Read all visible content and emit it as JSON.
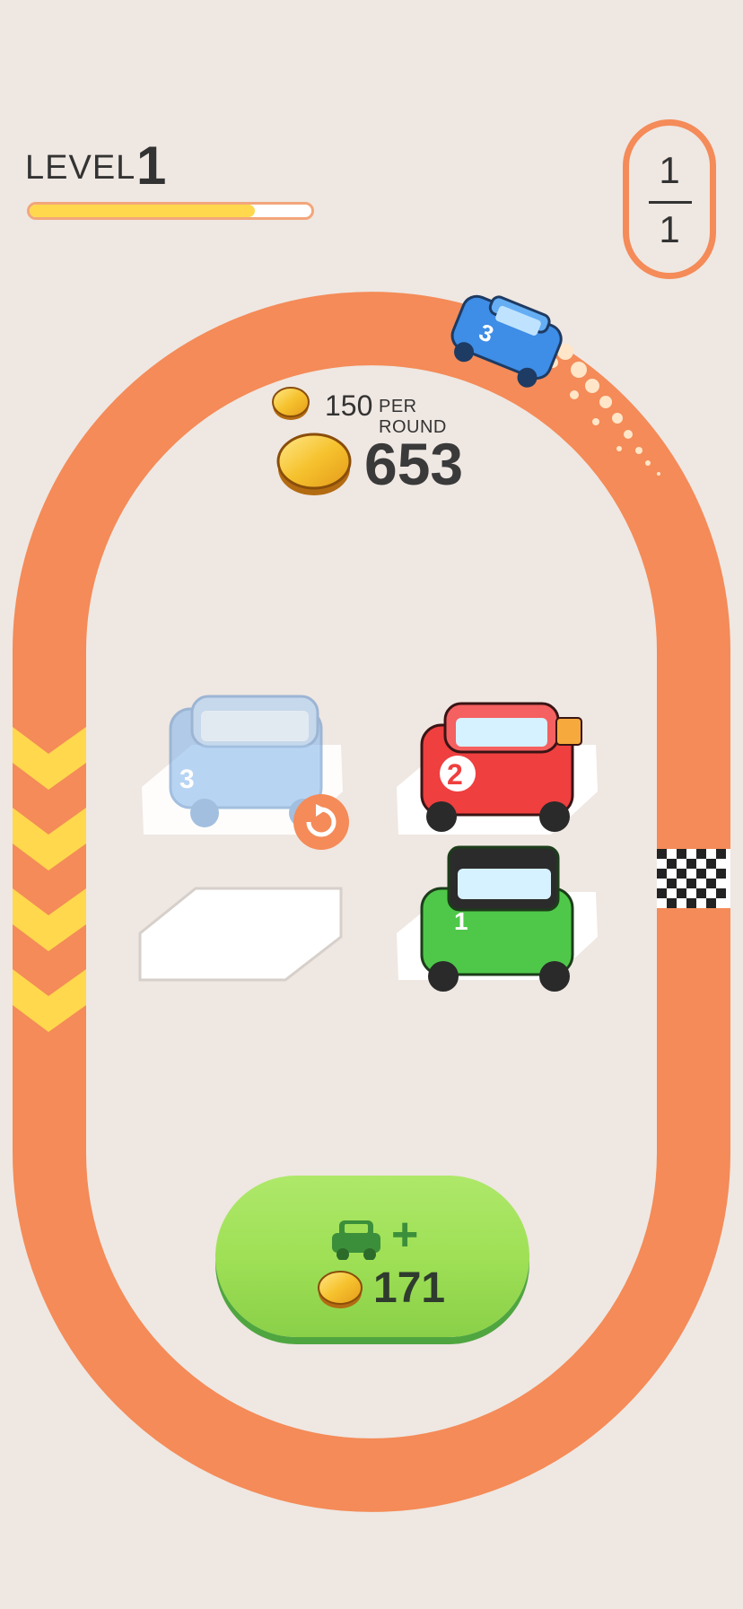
{
  "hud": {
    "level_label": "LEVEL",
    "level_number": "1",
    "level_progress": 0.8,
    "laps_completed": "1",
    "laps_total": "1"
  },
  "coins": {
    "per_round_value": "150",
    "per_round_label": "PER ROUND",
    "total": "653"
  },
  "cars": [
    {
      "slot": "top-left",
      "level": "3",
      "color": "#7fb3ec",
      "state": "ghost"
    },
    {
      "slot": "top-right",
      "level": "2",
      "color": "#ef3f3f",
      "state": "parked"
    },
    {
      "slot": "bottom-left",
      "level": "",
      "color": "",
      "state": "empty"
    },
    {
      "slot": "bottom-right",
      "level": "1",
      "color": "#4fc84a",
      "state": "parked"
    },
    {
      "slot": "track",
      "level": "3",
      "color": "#3e8de6",
      "state": "racing"
    }
  ],
  "buy_button": {
    "plus": "+",
    "price": "171"
  },
  "colors": {
    "background": "#efe7e2",
    "track": "#f48b58",
    "arrow": "#ffd84d",
    "button": "#9fe056",
    "coin": "#f6c22e"
  }
}
